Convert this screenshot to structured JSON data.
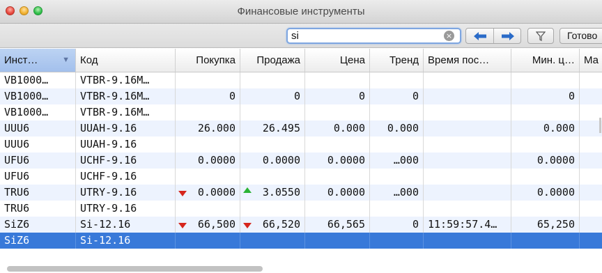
{
  "window": {
    "title": "Финансовые инструменты",
    "corner_glyph": "",
    "colors": {
      "close": "#e8473d",
      "minimize": "#f1b12f",
      "zoom": "#2fbf4a",
      "selection": "#3879d9",
      "sorted_header": "#a3c0ec"
    }
  },
  "toolbar": {
    "search_value": "si",
    "clear_icon": "×",
    "back_icon": "arrow-left-icon",
    "forward_icon": "arrow-right-icon",
    "filter_icon": "funnel-icon",
    "done_label": "Готово"
  },
  "table": {
    "columns": [
      "Инст…",
      "Код",
      "Покупка",
      "Продажа",
      "Цена",
      "Тренд",
      "Время пос…",
      "Мин. ц…",
      "Ма"
    ],
    "sort_indicator": "▼",
    "rows": [
      {
        "inst": "VB1000…",
        "code": "VTBR-9.16M…",
        "buy": "",
        "sell": "",
        "price": "",
        "trend": "",
        "time": "",
        "min": "",
        "buy_dir": "",
        "sell_dir": ""
      },
      {
        "inst": "VB1000…",
        "code": "VTBR-9.16M…",
        "buy": "0",
        "sell": "0",
        "price": "0",
        "trend": "0",
        "time": "",
        "min": "0",
        "buy_dir": "",
        "sell_dir": ""
      },
      {
        "inst": "VB1000…",
        "code": "VTBR-9.16M…",
        "buy": "",
        "sell": "",
        "price": "",
        "trend": "",
        "time": "",
        "min": "",
        "buy_dir": "",
        "sell_dir": ""
      },
      {
        "inst": "UUU6",
        "code": "UUAH-9.16",
        "buy": "26.000",
        "sell": "26.495",
        "price": "0.000",
        "trend": "0.000",
        "time": "",
        "min": "0.000",
        "buy_dir": "",
        "sell_dir": ""
      },
      {
        "inst": "UUU6",
        "code": "UUAH-9.16",
        "buy": "",
        "sell": "",
        "price": "",
        "trend": "",
        "time": "",
        "min": "",
        "buy_dir": "",
        "sell_dir": ""
      },
      {
        "inst": "UFU6",
        "code": "UCHF-9.16",
        "buy": "0.0000",
        "sell": "0.0000",
        "price": "0.0000",
        "trend": "…000",
        "time": "",
        "min": "0.0000",
        "buy_dir": "",
        "sell_dir": ""
      },
      {
        "inst": "UFU6",
        "code": "UCHF-9.16",
        "buy": "",
        "sell": "",
        "price": "",
        "trend": "",
        "time": "",
        "min": "",
        "buy_dir": "",
        "sell_dir": ""
      },
      {
        "inst": "TRU6",
        "code": "UTRY-9.16",
        "buy": "0.0000",
        "sell": "3.0550",
        "price": "0.0000",
        "trend": "…000",
        "time": "",
        "min": "0.0000",
        "buy_dir": "down",
        "sell_dir": "up"
      },
      {
        "inst": "TRU6",
        "code": "UTRY-9.16",
        "buy": "",
        "sell": "",
        "price": "",
        "trend": "",
        "time": "",
        "min": "",
        "buy_dir": "",
        "sell_dir": ""
      },
      {
        "inst": "SiZ6",
        "code": "Si-12.16",
        "buy": "66,500",
        "sell": "66,520",
        "price": "66,565",
        "trend": "0",
        "time": "11:59:57.4…",
        "min": "65,250",
        "buy_dir": "down",
        "sell_dir": "down"
      },
      {
        "inst": "SiZ6",
        "code": "Si-12.16",
        "buy": "",
        "sell": "",
        "price": "",
        "trend": "",
        "time": "",
        "min": "",
        "buy_dir": "",
        "sell_dir": "",
        "selected": true
      }
    ]
  }
}
